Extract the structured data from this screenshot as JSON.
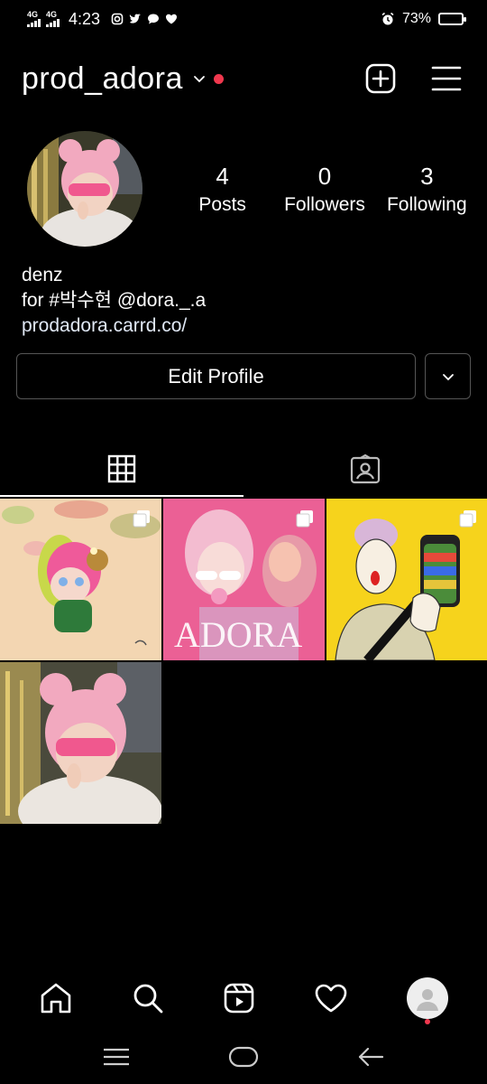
{
  "status_bar": {
    "network1": "4G",
    "network2": "4G",
    "time": "4:23",
    "battery": "73%",
    "battery_level": 0.73
  },
  "header": {
    "username": "prod_adora",
    "dot_color": "#f0384e"
  },
  "profile": {
    "posts_count": "4",
    "posts_label": "Posts",
    "followers_count": "0",
    "followers_label": "Followers",
    "following_count": "3",
    "following_label": "Following",
    "name": "denz",
    "bio_line": "for #박수현 @dora._.a",
    "link": "prodadora.carrd.co/"
  },
  "actions": {
    "edit_label": "Edit Profile"
  },
  "tabs": [
    "grid-icon",
    "tagged-icon"
  ],
  "posts": [
    {
      "id": "post-1",
      "alt_icon": "multi-image-icon",
      "overlay_text": ""
    },
    {
      "id": "post-2",
      "alt_icon": "multi-image-icon",
      "overlay_text": "ADORA"
    },
    {
      "id": "post-3",
      "alt_icon": "multi-image-icon",
      "overlay_text": ""
    },
    {
      "id": "post-4",
      "alt_icon": "",
      "overlay_text": ""
    }
  ],
  "bottom_nav": [
    "home-icon",
    "search-icon",
    "reels-icon",
    "heart-icon",
    "profile-avatar"
  ],
  "system_nav": [
    "recents-icon",
    "home-pill-icon",
    "back-icon"
  ]
}
